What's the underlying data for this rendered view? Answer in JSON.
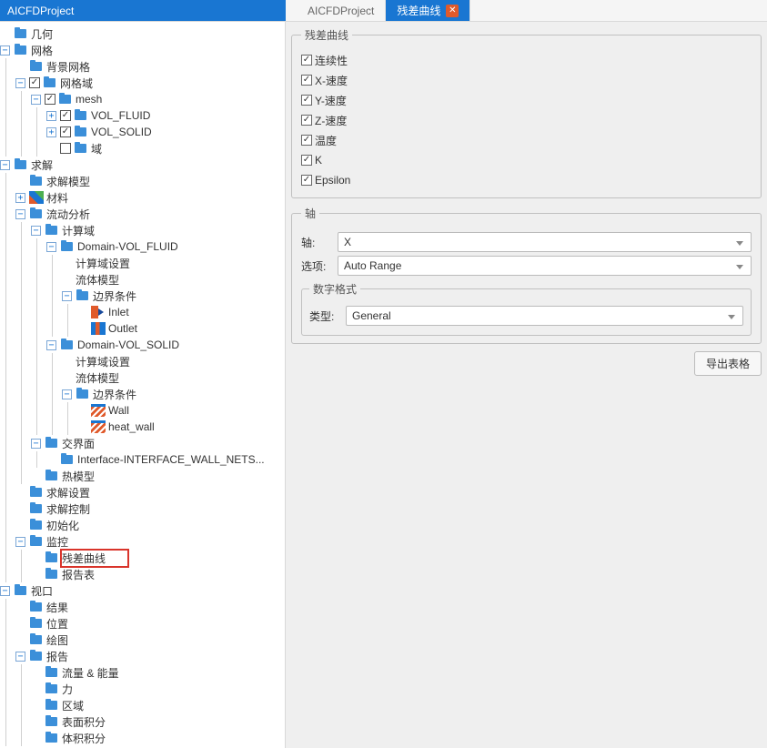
{
  "tabs": {
    "project": "AICFDProject",
    "doc1": "AICFDProject",
    "doc2": "残差曲线"
  },
  "tree": [
    {
      "d": 0,
      "t": "",
      "i": "folder",
      "l": "几何"
    },
    {
      "d": 0,
      "t": "−",
      "i": "folder",
      "l": "网格"
    },
    {
      "d": 1,
      "t": "",
      "i": "folder",
      "l": "背景网格"
    },
    {
      "d": 1,
      "t": "−",
      "c": true,
      "i": "folder",
      "l": "网格域"
    },
    {
      "d": 2,
      "t": "−",
      "c": true,
      "i": "folder",
      "l": "mesh"
    },
    {
      "d": 3,
      "t": "+",
      "c": true,
      "i": "folder",
      "l": "VOL_FLUID"
    },
    {
      "d": 3,
      "t": "+",
      "c": true,
      "i": "folder",
      "l": "VOL_SOLID"
    },
    {
      "d": 3,
      "t": "",
      "c": false,
      "i": "folder",
      "l": "域"
    },
    {
      "d": 0,
      "t": "−",
      "i": "folder",
      "l": "求解"
    },
    {
      "d": 1,
      "t": "",
      "i": "folder",
      "l": "求解模型"
    },
    {
      "d": 1,
      "t": "+",
      "i": "material",
      "l": "材料"
    },
    {
      "d": 1,
      "t": "−",
      "i": "folder",
      "l": "流动分析"
    },
    {
      "d": 2,
      "t": "−",
      "i": "folder",
      "l": "计算域"
    },
    {
      "d": 3,
      "t": "−",
      "i": "folder",
      "l": "Domain-VOL_FLUID"
    },
    {
      "d": 4,
      "t": "",
      "i": "",
      "l": "计算域设置"
    },
    {
      "d": 4,
      "t": "",
      "i": "",
      "l": "流体模型"
    },
    {
      "d": 4,
      "t": "−",
      "i": "folder",
      "l": "边界条件"
    },
    {
      "d": 5,
      "t": "",
      "i": "inlet",
      "l": "Inlet"
    },
    {
      "d": 5,
      "t": "",
      "i": "outlet",
      "l": "Outlet"
    },
    {
      "d": 3,
      "t": "−",
      "i": "folder",
      "l": "Domain-VOL_SOLID"
    },
    {
      "d": 4,
      "t": "",
      "i": "",
      "l": "计算域设置"
    },
    {
      "d": 4,
      "t": "",
      "i": "",
      "l": "流体模型"
    },
    {
      "d": 4,
      "t": "−",
      "i": "folder",
      "l": "边界条件"
    },
    {
      "d": 5,
      "t": "",
      "i": "wall",
      "l": "Wall"
    },
    {
      "d": 5,
      "t": "",
      "i": "wall",
      "l": "heat_wall"
    },
    {
      "d": 2,
      "t": "−",
      "i": "folder",
      "l": "交界面"
    },
    {
      "d": 3,
      "t": "",
      "i": "folder",
      "l": "Interface-INTERFACE_WALL_NETS..."
    },
    {
      "d": 2,
      "t": "",
      "i": "folder",
      "l": "热模型"
    },
    {
      "d": 1,
      "t": "",
      "i": "folder",
      "l": "求解设置"
    },
    {
      "d": 1,
      "t": "",
      "i": "folder",
      "l": "求解控制"
    },
    {
      "d": 1,
      "t": "",
      "i": "folder",
      "l": "初始化"
    },
    {
      "d": 1,
      "t": "−",
      "i": "folder",
      "l": "监控"
    },
    {
      "d": 2,
      "t": "",
      "i": "folder",
      "l": "残差曲线",
      "hl": true
    },
    {
      "d": 2,
      "t": "",
      "i": "folder",
      "l": "报告表"
    },
    {
      "d": 0,
      "t": "−",
      "i": "folder",
      "l": "视口"
    },
    {
      "d": 1,
      "t": "",
      "i": "folder",
      "l": "结果"
    },
    {
      "d": 1,
      "t": "",
      "i": "folder",
      "l": "位置"
    },
    {
      "d": 1,
      "t": "",
      "i": "folder",
      "l": "绘图"
    },
    {
      "d": 1,
      "t": "−",
      "i": "folder",
      "l": "报告"
    },
    {
      "d": 2,
      "t": "",
      "i": "folder",
      "l": "流量 & 能量"
    },
    {
      "d": 2,
      "t": "",
      "i": "folder",
      "l": "力"
    },
    {
      "d": 2,
      "t": "",
      "i": "folder",
      "l": "区域"
    },
    {
      "d": 2,
      "t": "",
      "i": "folder",
      "l": "表面积分"
    },
    {
      "d": 2,
      "t": "",
      "i": "folder",
      "l": "体积积分"
    }
  ],
  "panel": {
    "curves_title": "残差曲线",
    "curves": [
      "连续性",
      "X-速度",
      "Y-速度",
      "Z-速度",
      "温度",
      "K",
      "Epsilon"
    ],
    "axis_title": "轴",
    "axis_label": "轴:",
    "axis_value": "X",
    "option_label": "选项:",
    "option_value": "Auto Range",
    "numfmt_title": "数字格式",
    "type_label": "类型:",
    "type_value": "General",
    "export_btn": "导出表格"
  }
}
